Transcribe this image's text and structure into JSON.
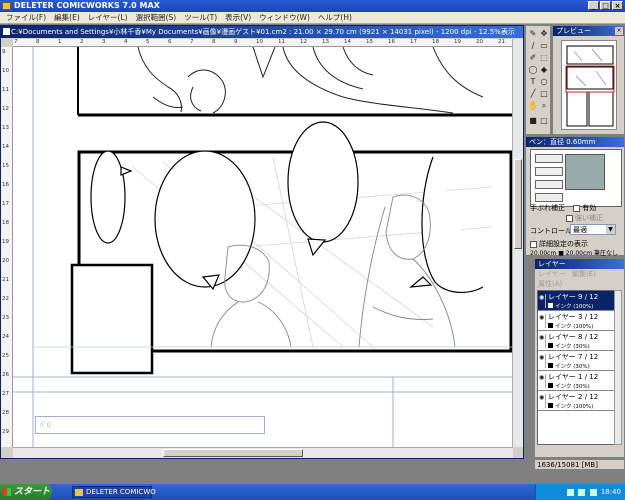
{
  "app": {
    "title": "DELETER COMICWORKS  7.0 MAX",
    "menus": [
      "ファイル(F)",
      "編集(E)",
      "レイヤー(L)",
      "選択範囲(S)",
      "ツール(T)",
      "表示(V)",
      "ウィンドウ(W)",
      "ヘルプ(H)"
    ]
  },
  "document": {
    "title": "C:¥Documents and Settings¥小林千香¥My Documents¥画像¥漫画ゲスト¥01.cm2  : 21.00 × 29.70 cm (9921 × 14031 pixel) - 1200 dpi - 12.5%表示",
    "ruler_top": [
      "7",
      "8",
      "1",
      "2",
      "3",
      "4",
      "5",
      "6",
      "7",
      "8",
      "9",
      "10",
      "11",
      "12",
      "13",
      "14",
      "15",
      "16",
      "17",
      "18",
      "19",
      "20",
      "21"
    ],
    "ruler_left": [
      "9",
      "10",
      "11",
      "12",
      "13",
      "14",
      "15",
      "16",
      "17",
      "18",
      "19",
      "20",
      "21",
      "22",
      "23",
      "24",
      "25",
      "26",
      "27",
      "28",
      "29"
    ],
    "status_box": "ﾊﾟﾛ"
  },
  "preview": {
    "title": "プレビュー"
  },
  "pen": {
    "title": "ペン：直径 0.60mm (14.2px)",
    "stabilize_label": "手ぶれ補正",
    "enable_label": "有効",
    "strong_label": "強い補正",
    "control_label": "コントロール",
    "control_value": "最適",
    "detail_label": "詳細設定の表示",
    "size_readout": "20.00cm ■ 20.00cm  筆圧なし"
  },
  "layers": {
    "title": "レイヤー",
    "menu": [
      "レイヤー",
      "編集(E)"
    ],
    "attr_label": "属性(A)",
    "items": [
      {
        "name": "レイヤー 9 / 12",
        "sub": "インク (100%)",
        "active": true
      },
      {
        "name": "レイヤー 3 / 12",
        "sub": "インク (100%)",
        "active": false
      },
      {
        "name": "レイヤー 8 / 12",
        "sub": "インク (30%)",
        "active": false
      },
      {
        "name": "レイヤー 7 / 12",
        "sub": "インク (30%)",
        "active": false
      },
      {
        "name": "レイヤー 1 / 12",
        "sub": "インク (30%)",
        "active": false
      },
      {
        "name": "レイヤー 2 / 12",
        "sub": "インク (100%)",
        "active": false
      }
    ],
    "memory": "1636/15081 [MB]"
  },
  "taskbar": {
    "start_label": "スタート",
    "task_label": "DELETER COMICWO",
    "clock": "18:40"
  }
}
